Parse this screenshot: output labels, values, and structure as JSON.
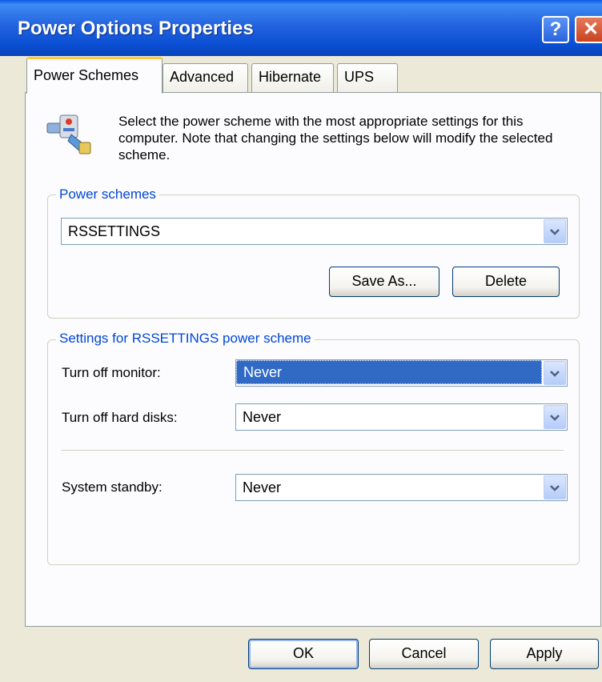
{
  "window": {
    "title": "Power Options Properties",
    "help_glyph": "?",
    "close_glyph": "✕"
  },
  "tabs": [
    {
      "label": "Power Schemes",
      "active": true
    },
    {
      "label": "Advanced",
      "active": false
    },
    {
      "label": "Hibernate",
      "active": false
    },
    {
      "label": "UPS",
      "active": false
    }
  ],
  "description": "Select the power scheme with the most appropriate settings for this computer. Note that changing the settings below will modify the selected scheme.",
  "power_schemes": {
    "group_label": "Power schemes",
    "selected": "RSSETTINGS",
    "save_as_label": "Save As...",
    "delete_label": "Delete"
  },
  "settings": {
    "group_label": "Settings for RSSETTINGS power scheme",
    "monitor_label": "Turn off monitor:",
    "monitor_value": "Never",
    "disks_label": "Turn off hard disks:",
    "disks_value": "Never",
    "standby_label": "System standby:",
    "standby_value": "Never"
  },
  "footer": {
    "ok_label": "OK",
    "cancel_label": "Cancel",
    "apply_label": "Apply"
  },
  "colors": {
    "titlebar": "#0a4fd3",
    "group_label": "#0046d5",
    "selection": "#316ac5",
    "active_tab_accent": "#ffc83c"
  }
}
